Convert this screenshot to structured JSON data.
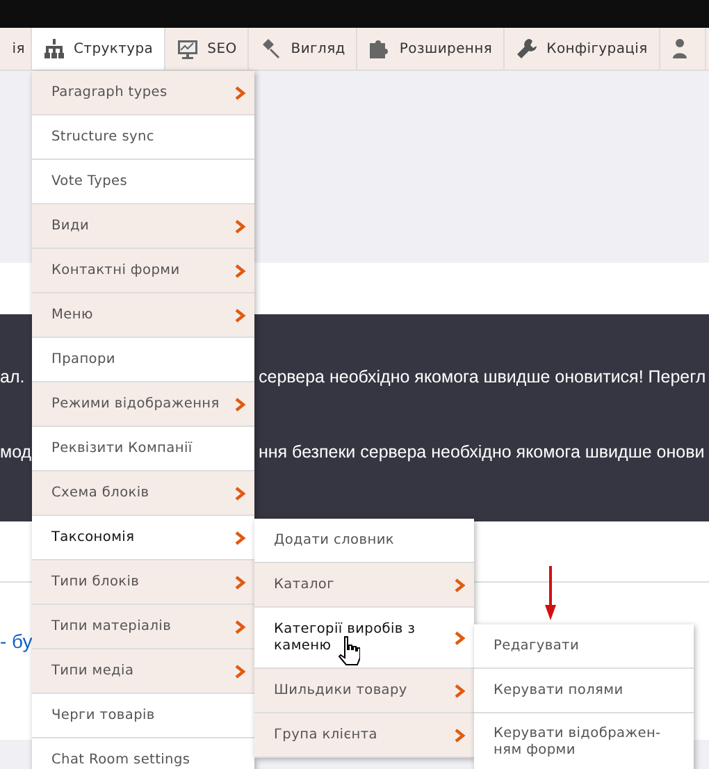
{
  "toolbar": {
    "tabs": [
      {
        "label": "ія",
        "selected": false
      },
      {
        "label": "Структура",
        "selected": true
      },
      {
        "label": "SEO",
        "selected": false
      },
      {
        "label": "Вигляд",
        "selected": false
      },
      {
        "label": "Розширення",
        "selected": false
      },
      {
        "label": "Конфігурація",
        "selected": false
      },
      {
        "selected": false
      }
    ]
  },
  "messages": [
    {
      "before": "ал.",
      "after": "сервера необхідно якомога швидше оновитися! Перегл"
    },
    {
      "before": "мод",
      "after": "ння безпеки сервера необхідно якомога швидше онови"
    }
  ],
  "content_text": "- бу",
  "menu": [
    {
      "label": "Paragraph types",
      "has_children": true,
      "selected": false
    },
    {
      "label": "Structure sync",
      "has_children": false,
      "selected": false
    },
    {
      "label": "Vote Types",
      "has_children": false,
      "selected": false
    },
    {
      "label": "Види",
      "has_children": true,
      "selected": false
    },
    {
      "label": "Контактні форми",
      "has_children": true,
      "selected": false
    },
    {
      "label": "Меню",
      "has_children": true,
      "selected": false
    },
    {
      "label": "Прапори",
      "has_children": false,
      "selected": false
    },
    {
      "label": "Режими відображення",
      "has_children": true,
      "selected": false
    },
    {
      "label": "Реквізити Компанії",
      "has_children": false,
      "selected": false
    },
    {
      "label": "Схема блоків",
      "has_children": true,
      "selected": false
    },
    {
      "label": "Таксономія",
      "has_children": true,
      "selected": true
    },
    {
      "label": "Типи блоків",
      "has_children": true,
      "selected": false
    },
    {
      "label": "Типи матеріалів",
      "has_children": true,
      "selected": false
    },
    {
      "label": "Типи медіа",
      "has_children": true,
      "selected": false
    },
    {
      "label": "Черги товарів",
      "has_children": false,
      "selected": false
    },
    {
      "label": "Chat Room settings",
      "has_children": false,
      "selected": false
    }
  ],
  "submenu": [
    {
      "label": "Додати словник",
      "has_children": false,
      "selected": false
    },
    {
      "label": "Каталог",
      "has_children": true,
      "selected": false
    },
    {
      "label": "Категорії виробів з каменю",
      "has_children": true,
      "selected": true
    },
    {
      "label": "Шильдики товару",
      "has_children": true,
      "selected": false
    },
    {
      "label": "Група клієнта",
      "has_children": true,
      "selected": false
    }
  ],
  "submenu_2": [
    {
      "label": "Редагувати",
      "has_children": false,
      "selected": false
    },
    {
      "label": "Керувати полями",
      "has_children": false,
      "selected": false
    },
    {
      "label": "Керувати відображен-ням форми",
      "has_children": false,
      "selected": false
    }
  ]
}
